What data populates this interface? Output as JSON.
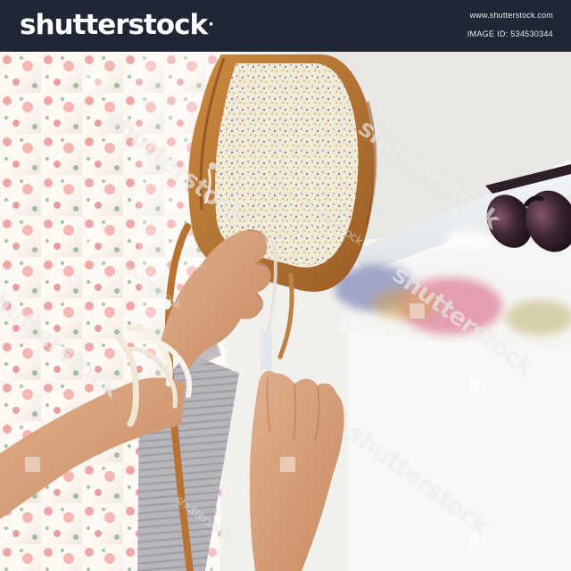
{
  "header": {
    "brand": "shutterstock",
    "brand_mark": "·",
    "site": "www.shutterstock.com",
    "image_id": "IMAGE ID: 534530344"
  },
  "watermarks": {
    "big": "shutterstock",
    "small": "shutterstock"
  },
  "icons": {
    "watermark": "watermark-square-icon"
  }
}
